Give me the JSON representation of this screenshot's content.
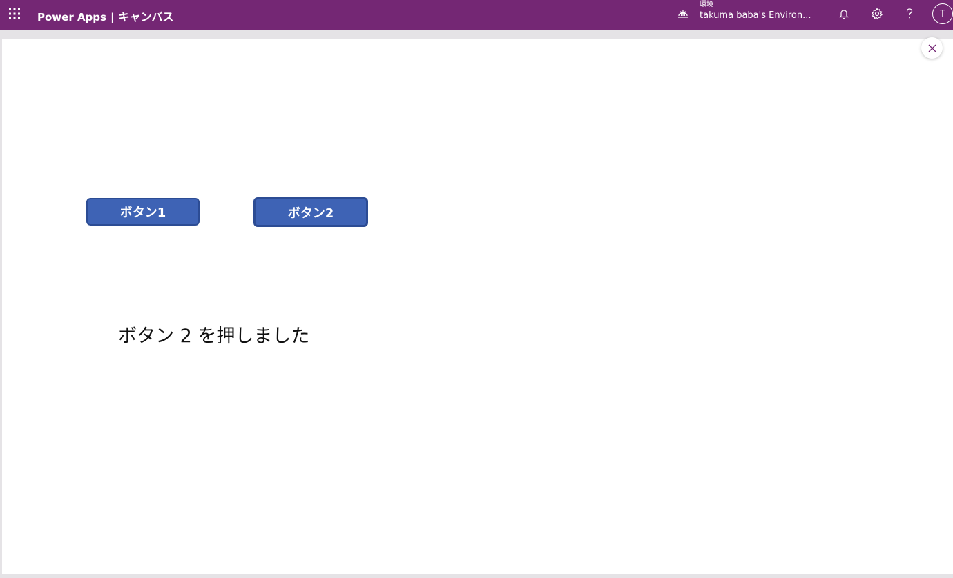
{
  "header": {
    "app_name": "Power Apps",
    "separator": "|",
    "mode": "キャンバス",
    "environment_label": "環境",
    "environment_name": "takuma baba's Environ...",
    "avatar_initial": "T",
    "icons": {
      "waffle": "waffle-icon",
      "environment": "globe-icon",
      "notifications": "bell-icon",
      "settings": "gear-icon",
      "help": "help-icon"
    },
    "brand_color": "#742774"
  },
  "canvas": {
    "button1_label": "ボタン1",
    "button2_label": "ボタン2",
    "result_text": "ボタン 2 を押しました",
    "button_color": "#3e63b5"
  },
  "preview": {
    "close_icon": "close-icon"
  }
}
